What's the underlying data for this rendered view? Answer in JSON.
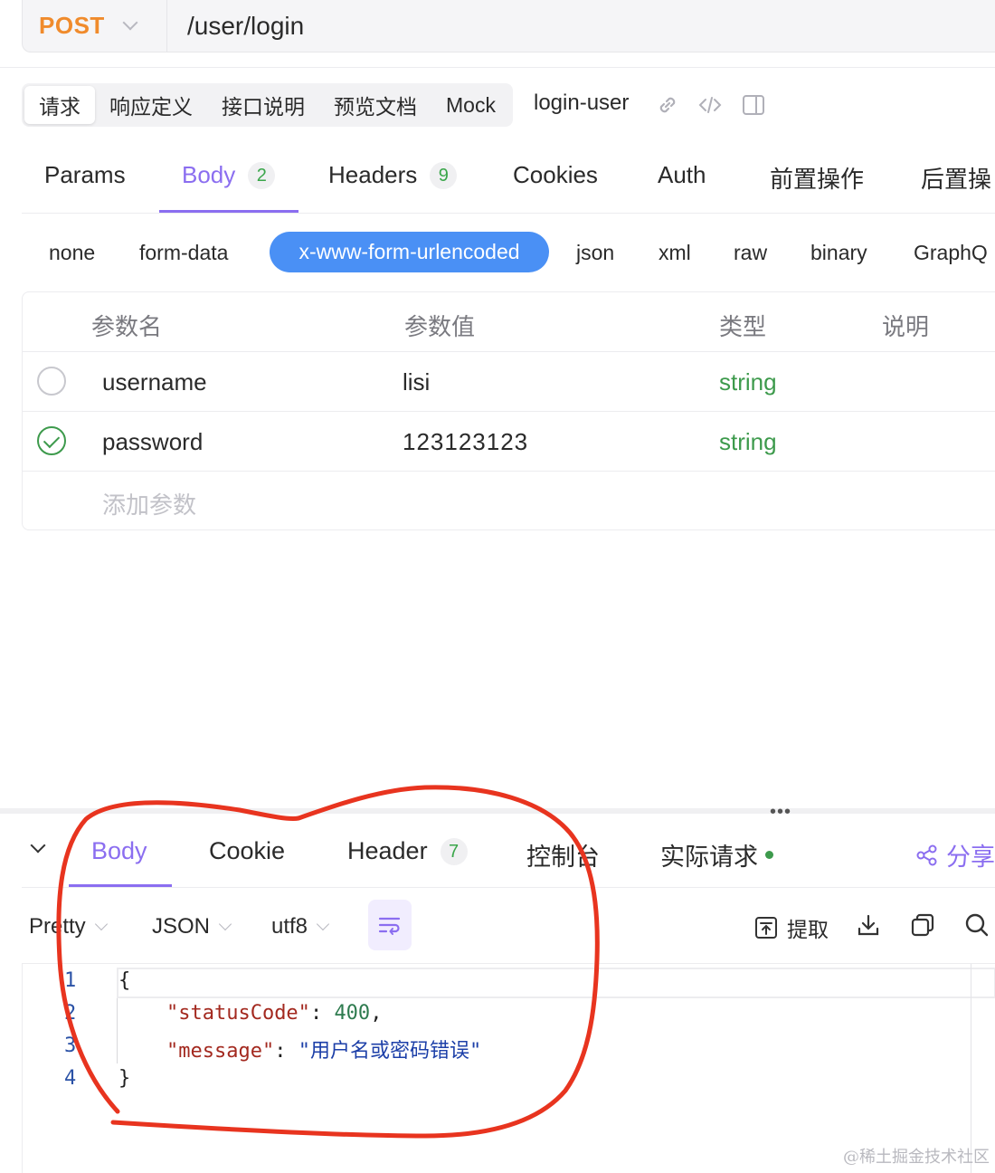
{
  "request": {
    "method": "POST",
    "url": "/user/login"
  },
  "top_tabs": [
    "请求",
    "响应定义",
    "接口说明",
    "预览文档",
    "Mock"
  ],
  "api_name": "login-user",
  "param_tabs": {
    "params": "Params",
    "body": "Body",
    "body_count": "2",
    "headers": "Headers",
    "headers_count": "9",
    "cookies": "Cookies",
    "auth": "Auth",
    "pre": "前置操作",
    "post": "后置操"
  },
  "body_types": {
    "none": "none",
    "form_data": "form-data",
    "urlencoded": "x-www-form-urlencoded",
    "json": "json",
    "xml": "xml",
    "raw": "raw",
    "binary": "binary",
    "graphql": "GraphQ"
  },
  "params_table": {
    "headers": {
      "name": "参数名",
      "value": "参数值",
      "type": "类型",
      "desc": "说明"
    },
    "rows": [
      {
        "name": "username",
        "value": "lisi",
        "type": "string",
        "enabled": false
      },
      {
        "name": "password",
        "value": "123123123",
        "type": "string",
        "enabled": true
      }
    ],
    "add_placeholder": "添加参数"
  },
  "response": {
    "tabs": {
      "body": "Body",
      "cookie": "Cookie",
      "header": "Header",
      "header_count": "7",
      "console": "控制台",
      "actual": "实际请求"
    },
    "share": "分享",
    "format": {
      "mode": "Pretty",
      "lang": "JSON",
      "encoding": "utf8"
    },
    "tools": {
      "extract": "提取"
    },
    "code": {
      "line_numbers": [
        "1",
        "2",
        "3",
        "4"
      ],
      "open": "{",
      "key1": "\"statusCode\"",
      "val1": "400",
      "key2": "\"message\"",
      "val2": "\"用户名或密码错误\"",
      "close": "}"
    }
  },
  "watermark": "@稀土掘金技术社区",
  "colors": {
    "accent": "#8b6ef0",
    "method": "#f08b2c",
    "pill": "#4a90f5",
    "type": "#3d9a4c",
    "annotation": "#e8341f"
  }
}
